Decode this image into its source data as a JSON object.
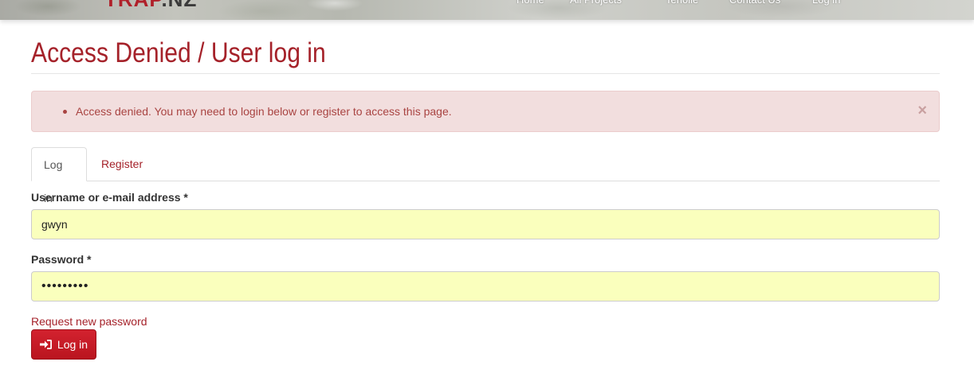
{
  "header": {
    "brand_part1": "TRAP",
    "brand_part2": ".NZ",
    "nav": [
      "Home",
      "All Projects",
      "Tenolie",
      "Contact Us",
      "Log in"
    ]
  },
  "page": {
    "title": "Access Denied / User log in"
  },
  "alert": {
    "message": "Access denied. You may need to login below or register to access this page.",
    "close_symbol": "×"
  },
  "tabs": [
    {
      "label": "Log in",
      "active": true
    },
    {
      "label": "Register",
      "active": false
    }
  ],
  "form": {
    "username_label": "Username or e-mail address",
    "username_value": "gwyn",
    "password_label": "Password",
    "password_value": "•••••••••",
    "required_marker": "*",
    "request_password_link": "Request new password",
    "submit_label": "Log in",
    "submit_icon": "sign-in-icon"
  },
  "colors": {
    "accent": "#a5222a",
    "alert_bg": "#f2dede",
    "alert_text": "#a94442",
    "autofill_bg": "#faffbd",
    "button_bg": "#c81b26"
  }
}
